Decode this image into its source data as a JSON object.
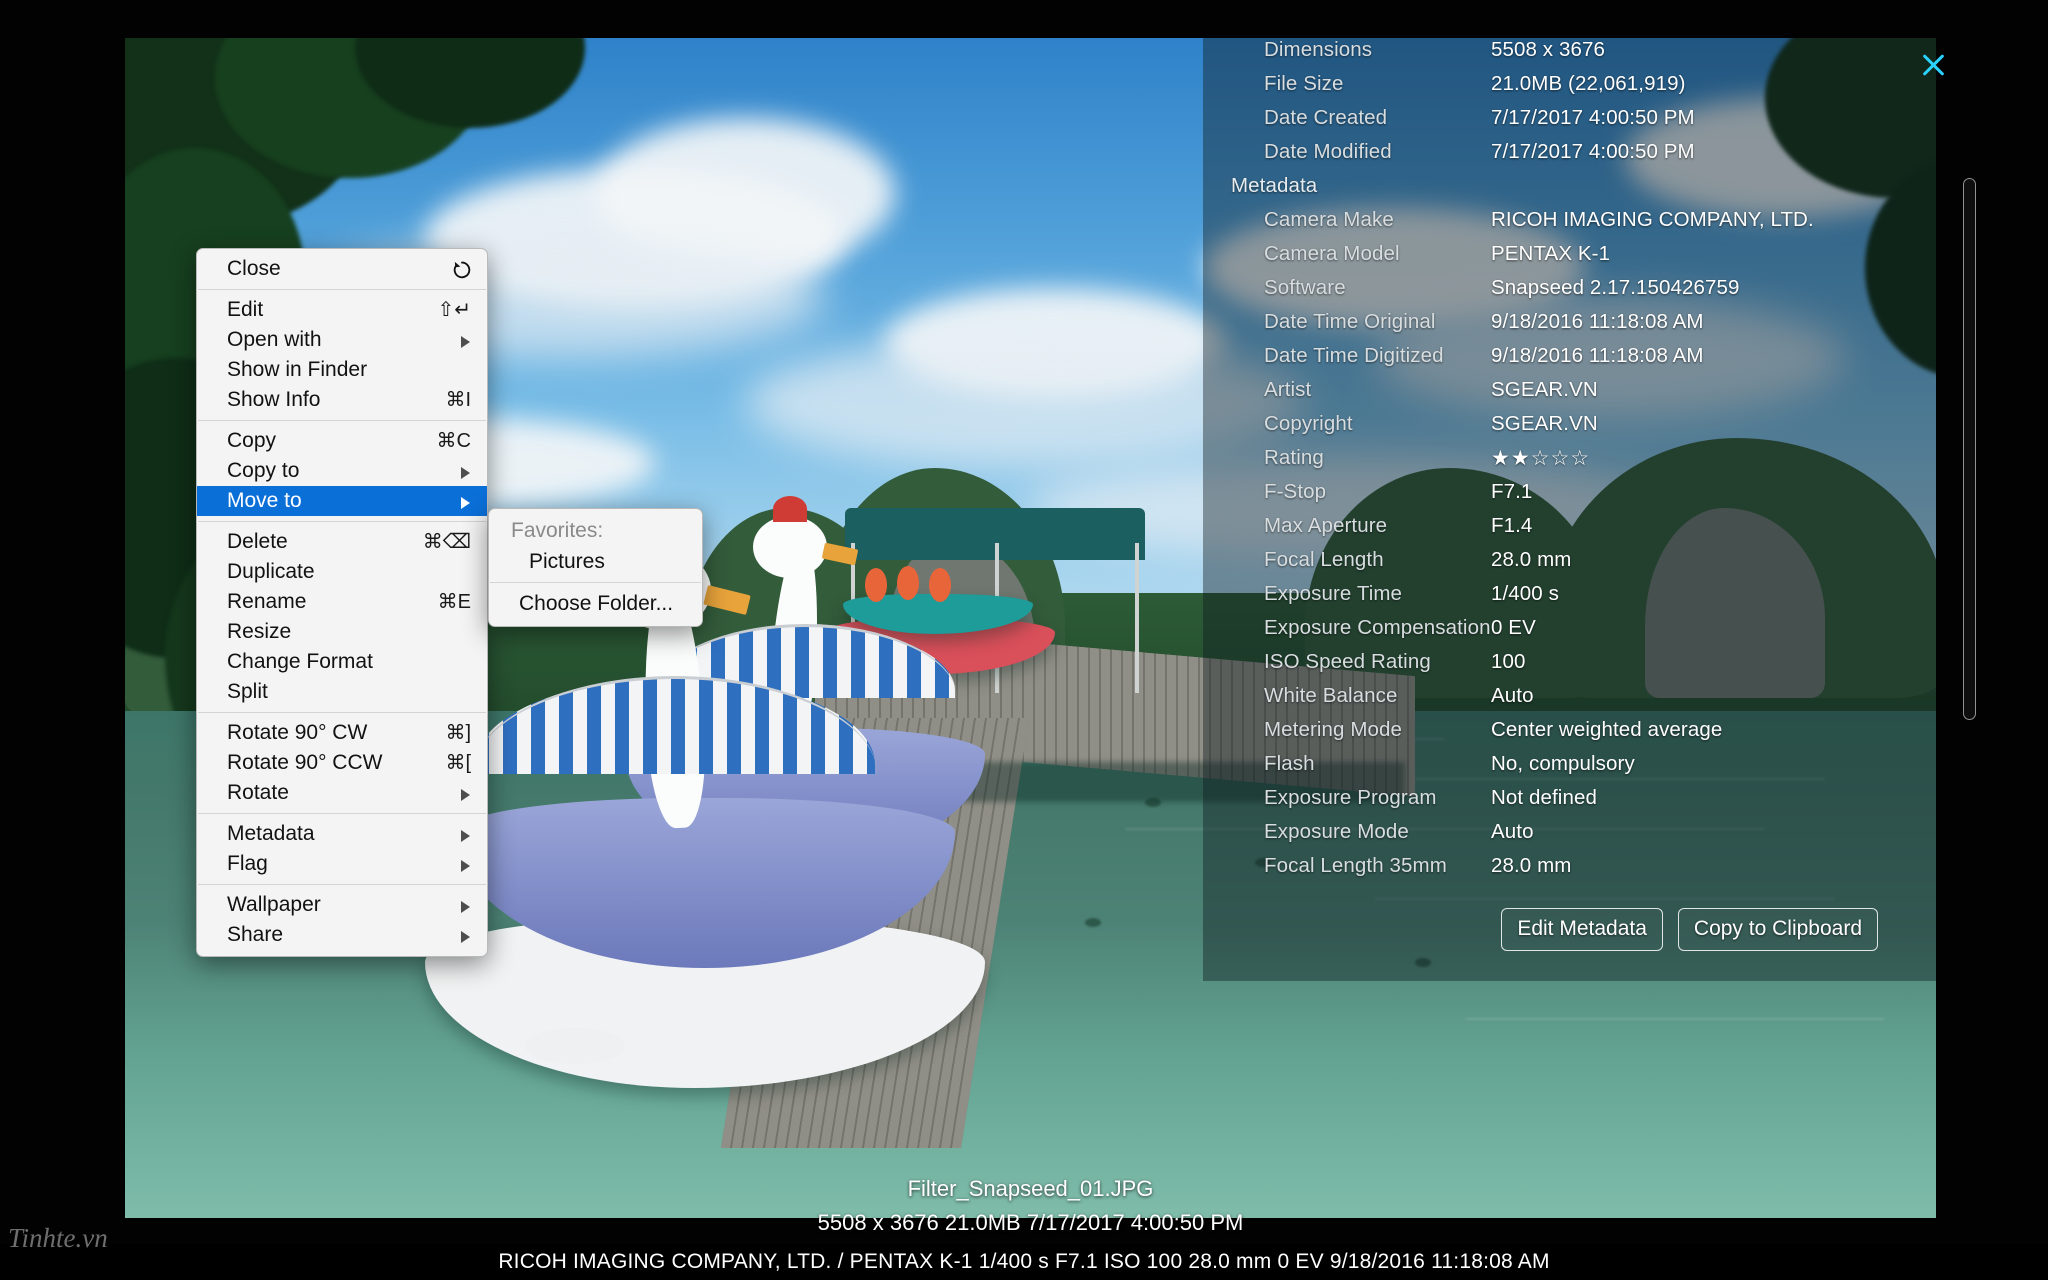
{
  "window": {
    "close_icon": "close-icon"
  },
  "metadata_panel": {
    "rows": [
      {
        "key": "Dimensions",
        "value": "5508 x 3676",
        "section": false
      },
      {
        "key": "File Size",
        "value": "21.0MB (22,061,919)",
        "section": false
      },
      {
        "key": "Date Created",
        "value": "7/17/2017 4:00:50 PM",
        "section": false
      },
      {
        "key": "Date Modified",
        "value": "7/17/2017 4:00:50 PM",
        "section": false
      },
      {
        "key": "Metadata",
        "value": "",
        "section": true
      },
      {
        "key": "Camera Make",
        "value": "RICOH IMAGING COMPANY, LTD.",
        "section": false
      },
      {
        "key": "Camera Model",
        "value": "PENTAX K-1",
        "section": false
      },
      {
        "key": "Software",
        "value": "Snapseed 2.17.150426759",
        "section": false
      },
      {
        "key": "Date Time Original",
        "value": "9/18/2016 11:18:08 AM",
        "section": false
      },
      {
        "key": "Date Time Digitized",
        "value": "9/18/2016 11:18:08 AM",
        "section": false
      },
      {
        "key": "Artist",
        "value": "SGEAR.VN",
        "section": false
      },
      {
        "key": "Copyright",
        "value": "SGEAR.VN",
        "section": false
      },
      {
        "key": "Rating",
        "value": "★★☆☆☆",
        "section": false
      },
      {
        "key": "F-Stop",
        "value": "F7.1",
        "section": false
      },
      {
        "key": "Max Aperture",
        "value": "F1.4",
        "section": false
      },
      {
        "key": "Focal Length",
        "value": "28.0 mm",
        "section": false
      },
      {
        "key": "Exposure Time",
        "value": "1/400 s",
        "section": false
      },
      {
        "key": "Exposure Compensation",
        "value": "0 EV",
        "section": false
      },
      {
        "key": "ISO Speed Rating",
        "value": "100",
        "section": false
      },
      {
        "key": "White Balance",
        "value": "Auto",
        "section": false
      },
      {
        "key": "Metering Mode",
        "value": "Center weighted average",
        "section": false
      },
      {
        "key": "Flash",
        "value": "No, compulsory",
        "section": false
      },
      {
        "key": "Exposure Program",
        "value": "Not defined",
        "section": false
      },
      {
        "key": "Exposure Mode",
        "value": "Auto",
        "section": false
      },
      {
        "key": "Focal Length 35mm",
        "value": "28.0 mm",
        "section": false
      }
    ],
    "rating_filled": 2,
    "rating_total": 5,
    "buttons": [
      {
        "label": "Edit Metadata",
        "name": "edit-metadata-button"
      },
      {
        "label": "Copy to Clipboard",
        "name": "copy-to-clipboard-button"
      }
    ]
  },
  "caption": {
    "filename": "Filter_Snapseed_01.JPG",
    "details": "5508 x 3676  21.0MB  7/17/2017 4:00:50 PM"
  },
  "statusbar": {
    "text": "RICOH IMAGING COMPANY, LTD. / PENTAX K-1  1/400 s  F7.1  ISO 100  28.0 mm  0 EV  9/18/2016 11:18:08 AM"
  },
  "watermark": {
    "text": "Tinhte.vn"
  },
  "context_menu": {
    "groups": [
      [
        {
          "label": "Close",
          "shortcut": "",
          "icon": "revert-icon",
          "submenu": false,
          "selected": false
        }
      ],
      [
        {
          "label": "Edit",
          "shortcut": "⇧↵",
          "icon": "",
          "submenu": false,
          "selected": false
        },
        {
          "label": "Open with",
          "shortcut": "",
          "icon": "",
          "submenu": true,
          "selected": false
        },
        {
          "label": "Show in Finder",
          "shortcut": "",
          "icon": "",
          "submenu": false,
          "selected": false
        },
        {
          "label": "Show Info",
          "shortcut": "⌘I",
          "icon": "",
          "submenu": false,
          "selected": false
        }
      ],
      [
        {
          "label": "Copy",
          "shortcut": "⌘C",
          "icon": "",
          "submenu": false,
          "selected": false
        },
        {
          "label": "Copy to",
          "shortcut": "",
          "icon": "",
          "submenu": true,
          "selected": false
        },
        {
          "label": "Move to",
          "shortcut": "",
          "icon": "",
          "submenu": true,
          "selected": true
        }
      ],
      [
        {
          "label": "Delete",
          "shortcut": "⌘⌫",
          "icon": "",
          "submenu": false,
          "selected": false
        },
        {
          "label": "Duplicate",
          "shortcut": "",
          "icon": "",
          "submenu": false,
          "selected": false
        },
        {
          "label": "Rename",
          "shortcut": "⌘E",
          "icon": "",
          "submenu": false,
          "selected": false
        },
        {
          "label": "Resize",
          "shortcut": "",
          "icon": "",
          "submenu": false,
          "selected": false
        },
        {
          "label": "Change Format",
          "shortcut": "",
          "icon": "",
          "submenu": false,
          "selected": false
        },
        {
          "label": "Split",
          "shortcut": "",
          "icon": "",
          "submenu": false,
          "selected": false
        }
      ],
      [
        {
          "label": "Rotate 90° CW",
          "shortcut": "⌘]",
          "icon": "",
          "submenu": false,
          "selected": false
        },
        {
          "label": "Rotate 90° CCW",
          "shortcut": "⌘[",
          "icon": "",
          "submenu": false,
          "selected": false
        },
        {
          "label": "Rotate",
          "shortcut": "",
          "icon": "",
          "submenu": true,
          "selected": false
        }
      ],
      [
        {
          "label": "Metadata",
          "shortcut": "",
          "icon": "",
          "submenu": true,
          "selected": false
        },
        {
          "label": "Flag",
          "shortcut": "",
          "icon": "",
          "submenu": true,
          "selected": false
        }
      ],
      [
        {
          "label": "Wallpaper",
          "shortcut": "",
          "icon": "",
          "submenu": true,
          "selected": false
        },
        {
          "label": "Share",
          "shortcut": "",
          "icon": "",
          "submenu": true,
          "selected": false
        }
      ]
    ]
  },
  "submenu": {
    "header": "Favorites:",
    "favorites": [
      "Pictures"
    ],
    "choose": "Choose Folder..."
  },
  "colors": {
    "menu_highlight": "#0b6fd8",
    "menu_bg": "#f4f4f4",
    "close_x": "#2ad2ff",
    "panel_overlay": "rgba(14,26,32,.42)"
  }
}
